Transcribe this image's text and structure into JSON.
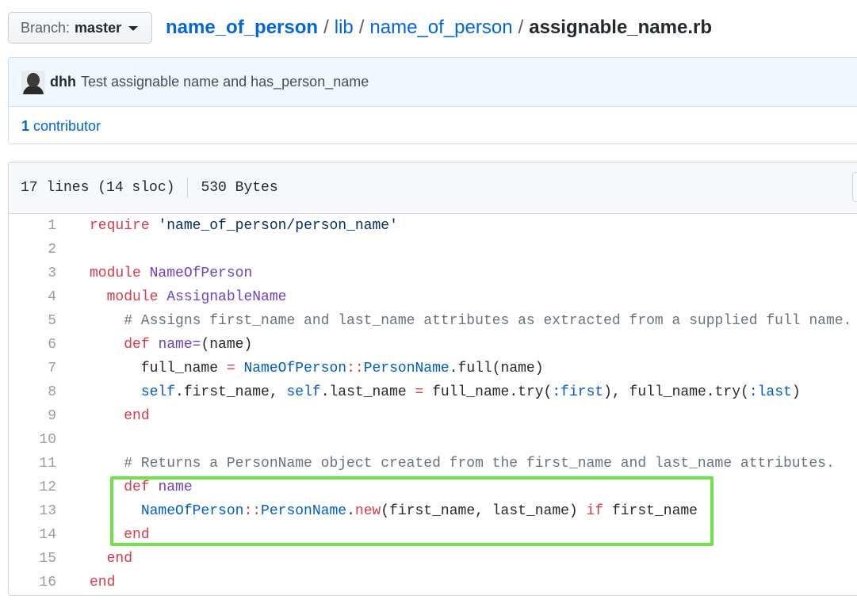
{
  "branch": {
    "label": "Branch:",
    "value": "master"
  },
  "breadcrumb": {
    "repo": "name_of_person",
    "sep1": "/",
    "dir1": "lib",
    "sep2": "/",
    "dir2": "name_of_person",
    "sep3": "/",
    "file": "assignable_name.rb"
  },
  "commit": {
    "author": "dhh",
    "message": "Test assignable name and has_person_name"
  },
  "contributors": {
    "count": "1",
    "label": "contributor"
  },
  "file_info": {
    "lines": "17 lines (14 sloc)",
    "size": "530 Bytes"
  },
  "code_lines": [
    {
      "n": "1",
      "parts": [
        [
          "k",
          "require"
        ],
        [
          "p",
          " "
        ],
        [
          "s",
          "'name_of_person/person_name'"
        ]
      ]
    },
    {
      "n": "2",
      "parts": []
    },
    {
      "n": "3",
      "parts": [
        [
          "k",
          "module"
        ],
        [
          "p",
          " "
        ],
        [
          "e",
          "NameOfPerson"
        ]
      ]
    },
    {
      "n": "4",
      "parts": [
        [
          "p",
          "  "
        ],
        [
          "k",
          "module"
        ],
        [
          "p",
          " "
        ],
        [
          "e",
          "AssignableName"
        ]
      ]
    },
    {
      "n": "5",
      "parts": [
        [
          "c",
          "    # Assigns first_name and last_name attributes as extracted from a supplied full name."
        ]
      ]
    },
    {
      "n": "6",
      "parts": [
        [
          "p",
          "    "
        ],
        [
          "k",
          "def"
        ],
        [
          "p",
          " "
        ],
        [
          "e",
          "name="
        ],
        [
          "p",
          "(name)"
        ]
      ]
    },
    {
      "n": "7",
      "parts": [
        [
          "p",
          "      full_name "
        ],
        [
          "k",
          "="
        ],
        [
          "p",
          " "
        ],
        [
          "v",
          "NameOfPerson"
        ],
        [
          "k",
          "::"
        ],
        [
          "v",
          "PersonName"
        ],
        [
          "p",
          ".full(name)"
        ]
      ]
    },
    {
      "n": "8",
      "parts": [
        [
          "p",
          "      "
        ],
        [
          "v",
          "self"
        ],
        [
          "p",
          ".first_name, "
        ],
        [
          "v",
          "self"
        ],
        [
          "p",
          ".last_name "
        ],
        [
          "k",
          "="
        ],
        [
          "p",
          " full_name.try("
        ],
        [
          "v",
          ":first"
        ],
        [
          "p",
          "), full_name.try("
        ],
        [
          "v",
          ":last"
        ],
        [
          "p",
          ")"
        ]
      ]
    },
    {
      "n": "9",
      "parts": [
        [
          "p",
          "    "
        ],
        [
          "k",
          "end"
        ]
      ]
    },
    {
      "n": "10",
      "parts": []
    },
    {
      "n": "11",
      "parts": [
        [
          "c",
          "    # Returns a PersonName object created from the first_name and last_name attributes."
        ]
      ]
    },
    {
      "n": "12",
      "parts": [
        [
          "p",
          "    "
        ],
        [
          "k",
          "def"
        ],
        [
          "p",
          " "
        ],
        [
          "e",
          "name"
        ]
      ]
    },
    {
      "n": "13",
      "parts": [
        [
          "p",
          "      "
        ],
        [
          "v",
          "NameOfPerson"
        ],
        [
          "k",
          "::"
        ],
        [
          "v",
          "PersonName"
        ],
        [
          "p",
          "."
        ],
        [
          "k",
          "new"
        ],
        [
          "p",
          "(first_name, last_name) "
        ],
        [
          "k",
          "if"
        ],
        [
          "p",
          " first_name"
        ]
      ]
    },
    {
      "n": "14",
      "parts": [
        [
          "p",
          "    "
        ],
        [
          "k",
          "end"
        ]
      ]
    },
    {
      "n": "15",
      "parts": [
        [
          "p",
          "  "
        ],
        [
          "k",
          "end"
        ]
      ]
    },
    {
      "n": "16",
      "parts": [
        [
          "k",
          "end"
        ]
      ]
    }
  ],
  "colors": {
    "highlight": "#6fe347",
    "link": "#0366d6",
    "keyword": "#d73a49",
    "entity": "#6f42c1",
    "constant": "#005cc5",
    "comment": "#6a737d",
    "string": "#032f62"
  }
}
